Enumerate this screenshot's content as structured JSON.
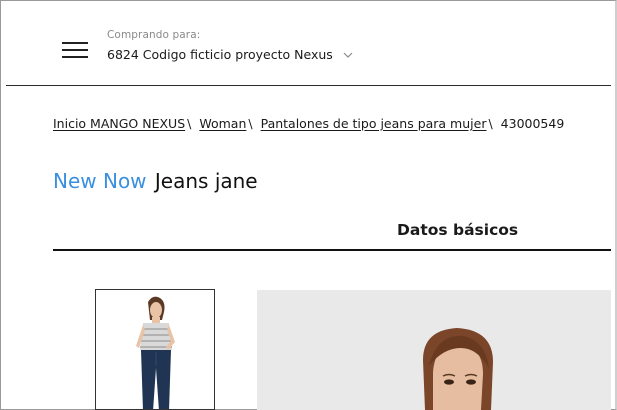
{
  "header": {
    "buying_for_label": "Comprando para:",
    "buying_for_value": "6824 Codigo ficticio proyecto Nexus"
  },
  "breadcrumb": {
    "items": [
      "Inicio MANGO NEXUS",
      "Woman",
      "Pantalones de tipo jeans para mujer"
    ],
    "current": "43000549"
  },
  "product": {
    "tag": "New Now",
    "name": "Jeans jane"
  },
  "tabs": {
    "active": "Datos básicos"
  },
  "colors": {
    "accent": "#3b8fe0",
    "divider": "#111111",
    "photo_bg": "#e9e9e9"
  },
  "icons": {
    "menu": "hamburger-icon",
    "dropdown": "chevron-down-icon"
  }
}
